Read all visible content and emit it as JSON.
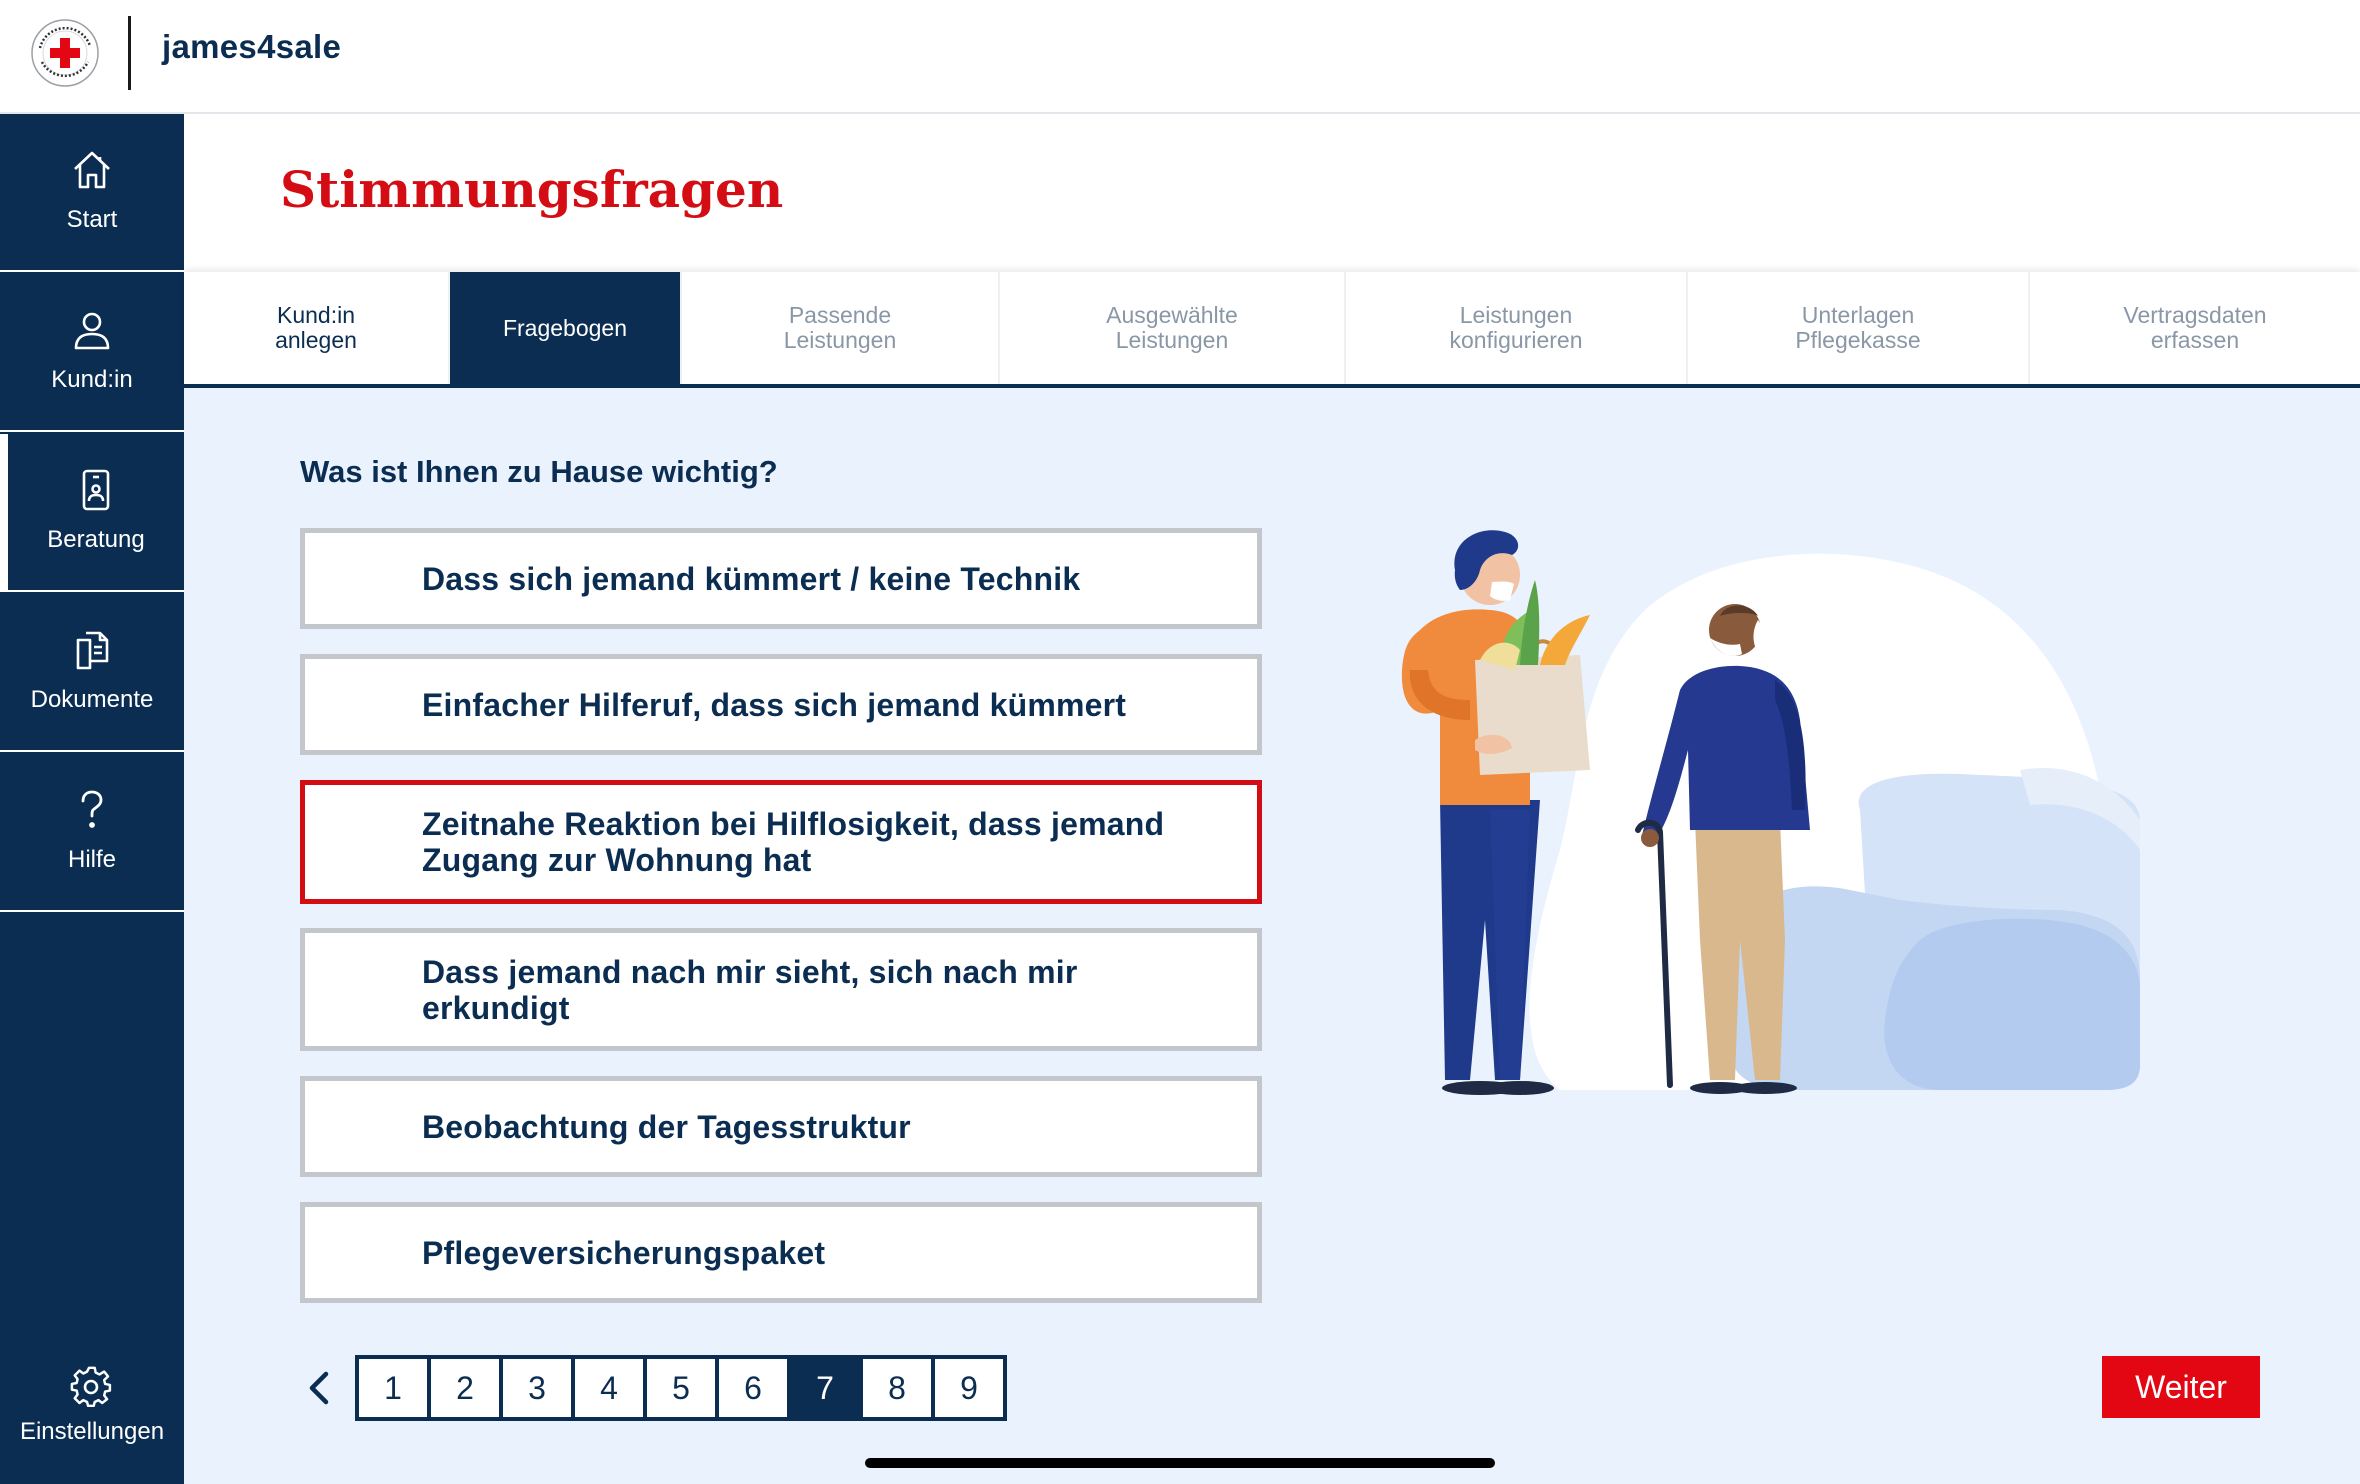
{
  "app": {
    "name": "james4sale",
    "logo_text": "DEUTSCHES ROTES KREUZ"
  },
  "sidebar": {
    "items": [
      {
        "label": "Start",
        "icon": "home-icon"
      },
      {
        "label": "Kund:in",
        "icon": "user-icon"
      },
      {
        "label": "Beratung",
        "icon": "tablet-user-icon",
        "active": true
      },
      {
        "label": "Dokumente",
        "icon": "documents-icon"
      },
      {
        "label": "Hilfe",
        "icon": "question-icon"
      }
    ],
    "settings": {
      "label": "Einstellungen",
      "icon": "gear-icon"
    }
  },
  "page": {
    "title": "Stimmungsfragen"
  },
  "tabs": [
    {
      "line1": "Kund:in",
      "line2": "anlegen",
      "state": "done"
    },
    {
      "line1": "Fragebogen",
      "line2": "",
      "state": "active"
    },
    {
      "line1": "Passende",
      "line2": "Leistungen",
      "state": "inactive"
    },
    {
      "line1": "Ausgewählte",
      "line2": "Leistungen",
      "state": "inactive"
    },
    {
      "line1": "Leistungen",
      "line2": "konfigurieren",
      "state": "inactive"
    },
    {
      "line1": "Unterlagen",
      "line2": "Pflegekasse",
      "state": "inactive"
    },
    {
      "line1": "Vertragsdaten",
      "line2": "erfassen",
      "state": "inactive"
    }
  ],
  "question": {
    "text": "Was ist Ihnen zu Hause wichtig?",
    "options": [
      {
        "line1": "Dass sich jemand kümmert / keine Technik",
        "line2": "",
        "selected": false
      },
      {
        "line1": "Einfacher Hilferuf, dass sich jemand kümmert",
        "line2": "",
        "selected": false
      },
      {
        "line1": "Zeitnahe Reaktion bei Hilflosigkeit, dass jemand",
        "line2": "Zugang zur Wohnung hat",
        "selected": true
      },
      {
        "line1": "Dass jemand nach mir sieht, sich nach mir",
        "line2": "erkundigt",
        "selected": false
      },
      {
        "line1": "Beobachtung der Tagesstruktur",
        "line2": "",
        "selected": false
      },
      {
        "line1": "Pflegeversicherungspaket",
        "line2": "",
        "selected": false
      }
    ]
  },
  "pagination": {
    "pages": [
      "1",
      "2",
      "3",
      "4",
      "5",
      "6",
      "7",
      "8",
      "9"
    ],
    "current": "7"
  },
  "actions": {
    "next_label": "Weiter"
  },
  "colors": {
    "navy": "#0b2d52",
    "red": "#d30d13",
    "button_red": "#e30613",
    "content_bg": "#eaf3fd",
    "option_border": "#c3c7cc"
  }
}
